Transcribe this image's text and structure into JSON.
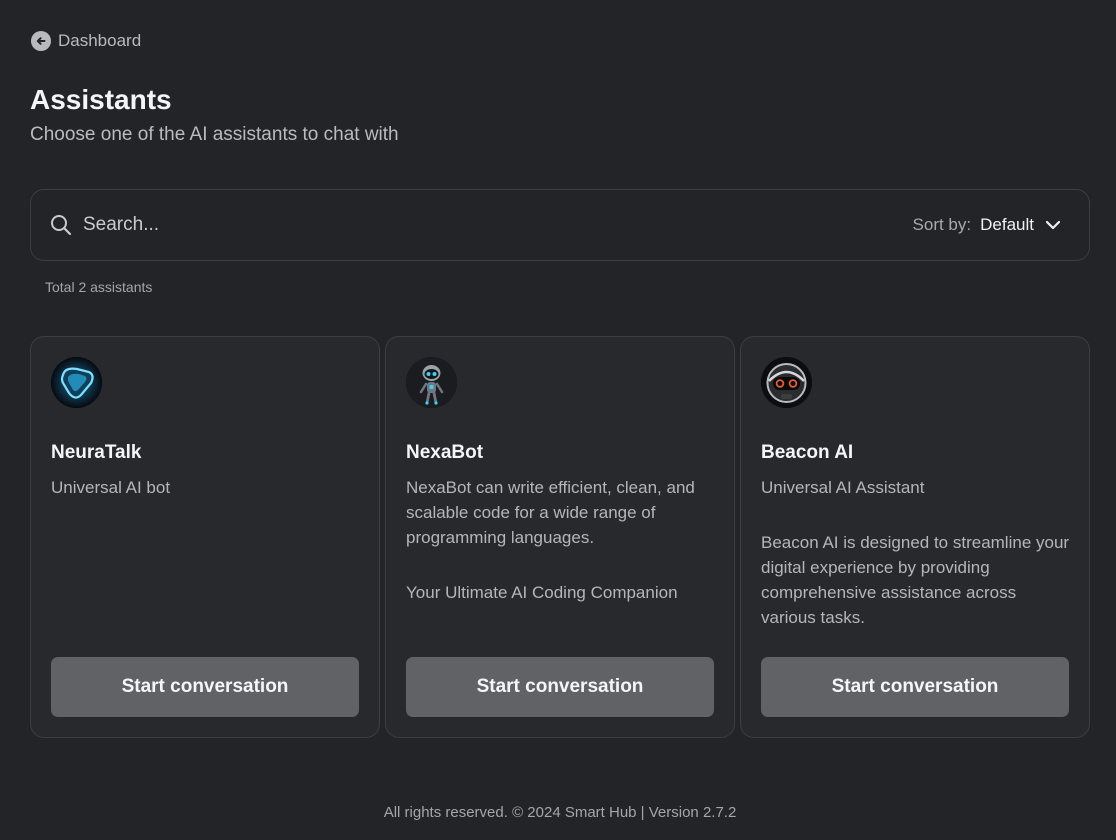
{
  "nav": {
    "back_label": "Dashboard"
  },
  "header": {
    "title": "Assistants",
    "subtitle": "Choose one of the AI assistants to chat with"
  },
  "search": {
    "placeholder": "Search..."
  },
  "sort": {
    "label": "Sort by:",
    "value": "Default"
  },
  "summary": {
    "total_text": "Total 2 assistants"
  },
  "assistants": [
    {
      "name": "NeuraTalk",
      "description": [
        "Universal AI bot"
      ],
      "button_label": "Start conversation",
      "avatar": "neuratalk-logo",
      "accent": "#3fb8e6"
    },
    {
      "name": "NexaBot",
      "description": [
        "NexaBot can write efficient, clean, and scalable code for a wide range of programming languages.",
        "Your Ultimate AI Coding Companion"
      ],
      "button_label": "Start conversation",
      "avatar": "robot-avatar",
      "accent": "#39d3f0"
    },
    {
      "name": "Beacon AI",
      "description": [
        "Universal AI Assistant",
        "Beacon AI is designed to streamline your digital experience by providing comprehensive assistance across various tasks."
      ],
      "button_label": "Start conversation",
      "avatar": "robot-helmet-avatar",
      "accent": "#f05a2a"
    }
  ],
  "footer": {
    "text": "All rights reserved. © 2024 Smart Hub | Version 2.7.2"
  }
}
